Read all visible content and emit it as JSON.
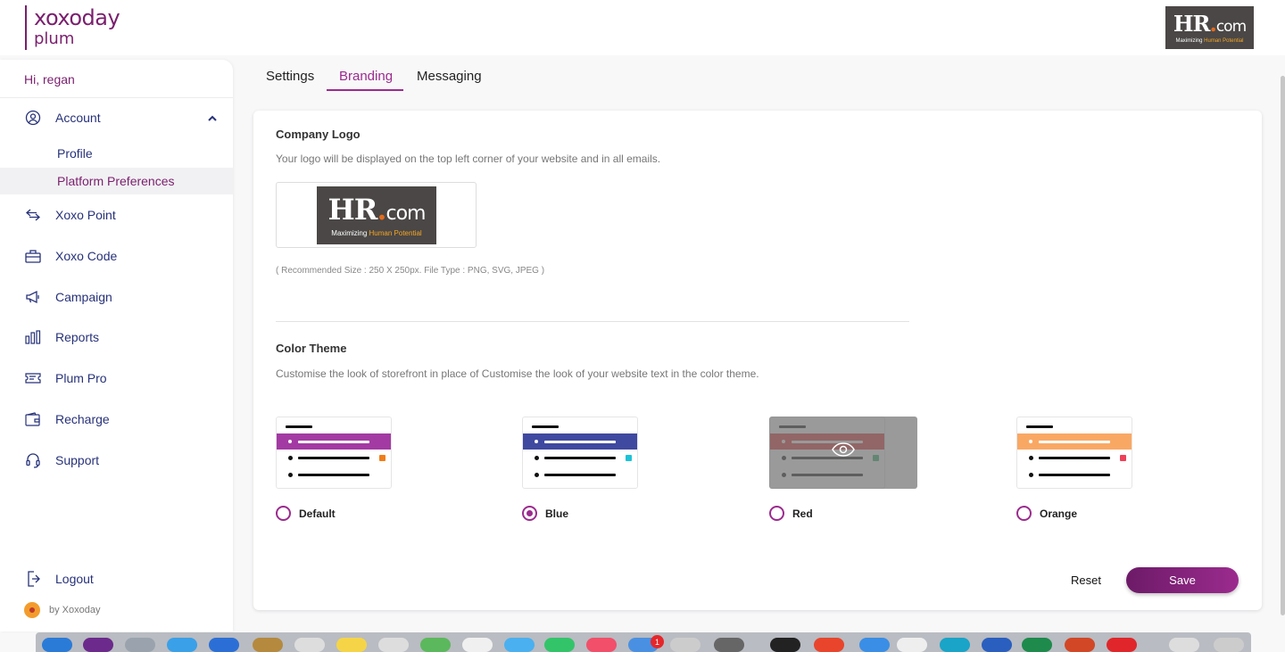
{
  "header": {
    "brand_line1": "xoxoday",
    "brand_line2": "plum",
    "company_logo": {
      "main": "HR",
      "dot": ".",
      "suffix": "com",
      "tagline_start": "Maximizing ",
      "tagline_accent": "Human Potential"
    }
  },
  "sidebar": {
    "greeting": "Hi, regan",
    "account": {
      "label": "Account",
      "icon": "user-circle-icon",
      "expanded": true
    },
    "account_subitems": [
      {
        "label": "Profile",
        "active": false
      },
      {
        "label": "Platform Preferences",
        "active": true
      }
    ],
    "items": [
      {
        "label": "Xoxo Point",
        "icon": "exchange-arrows-icon"
      },
      {
        "label": "Xoxo Code",
        "icon": "gift-card-icon"
      },
      {
        "label": "Campaign",
        "icon": "megaphone-icon"
      },
      {
        "label": "Reports",
        "icon": "bar-chart-icon"
      },
      {
        "label": "Plum Pro",
        "icon": "ticket-icon"
      },
      {
        "label": "Recharge",
        "icon": "wallet-icon"
      },
      {
        "label": "Support",
        "icon": "headset-icon"
      }
    ],
    "logout": "Logout",
    "footer": "by Xoxoday"
  },
  "tabs": [
    {
      "label": "Settings",
      "active": false
    },
    {
      "label": "Branding",
      "active": true
    },
    {
      "label": "Messaging",
      "active": false
    }
  ],
  "branding": {
    "logo_title": "Company Logo",
    "logo_desc": "Your logo will be displayed on the top left corner of your website and in all emails.",
    "logo_hint": "( Recommended Size : 250 X 250px. File Type : PNG, SVG, JPEG )",
    "theme_title": "Color Theme",
    "theme_desc": "Customise the look of storefront in place of Customise the look of your website text in the color theme.",
    "themes": [
      {
        "label": "Default",
        "band": "#a33aa3",
        "square": "#f07d1a",
        "selected": false
      },
      {
        "label": "Blue",
        "band": "#3f49a0",
        "square": "#1bc3d9",
        "selected": true
      },
      {
        "label": "Red",
        "band": "#d33",
        "square": "#27ae60",
        "selected": false
      },
      {
        "label": "Orange",
        "band": "#f9a864",
        "square": "#ef4056",
        "selected": false
      }
    ],
    "reset_label": "Reset",
    "save_label": "Save"
  },
  "colors": {
    "accent": "#9b2b8e",
    "brand": "#7a1f6e",
    "nav_text": "#27327a"
  },
  "dock": {
    "badge_count": "1"
  }
}
